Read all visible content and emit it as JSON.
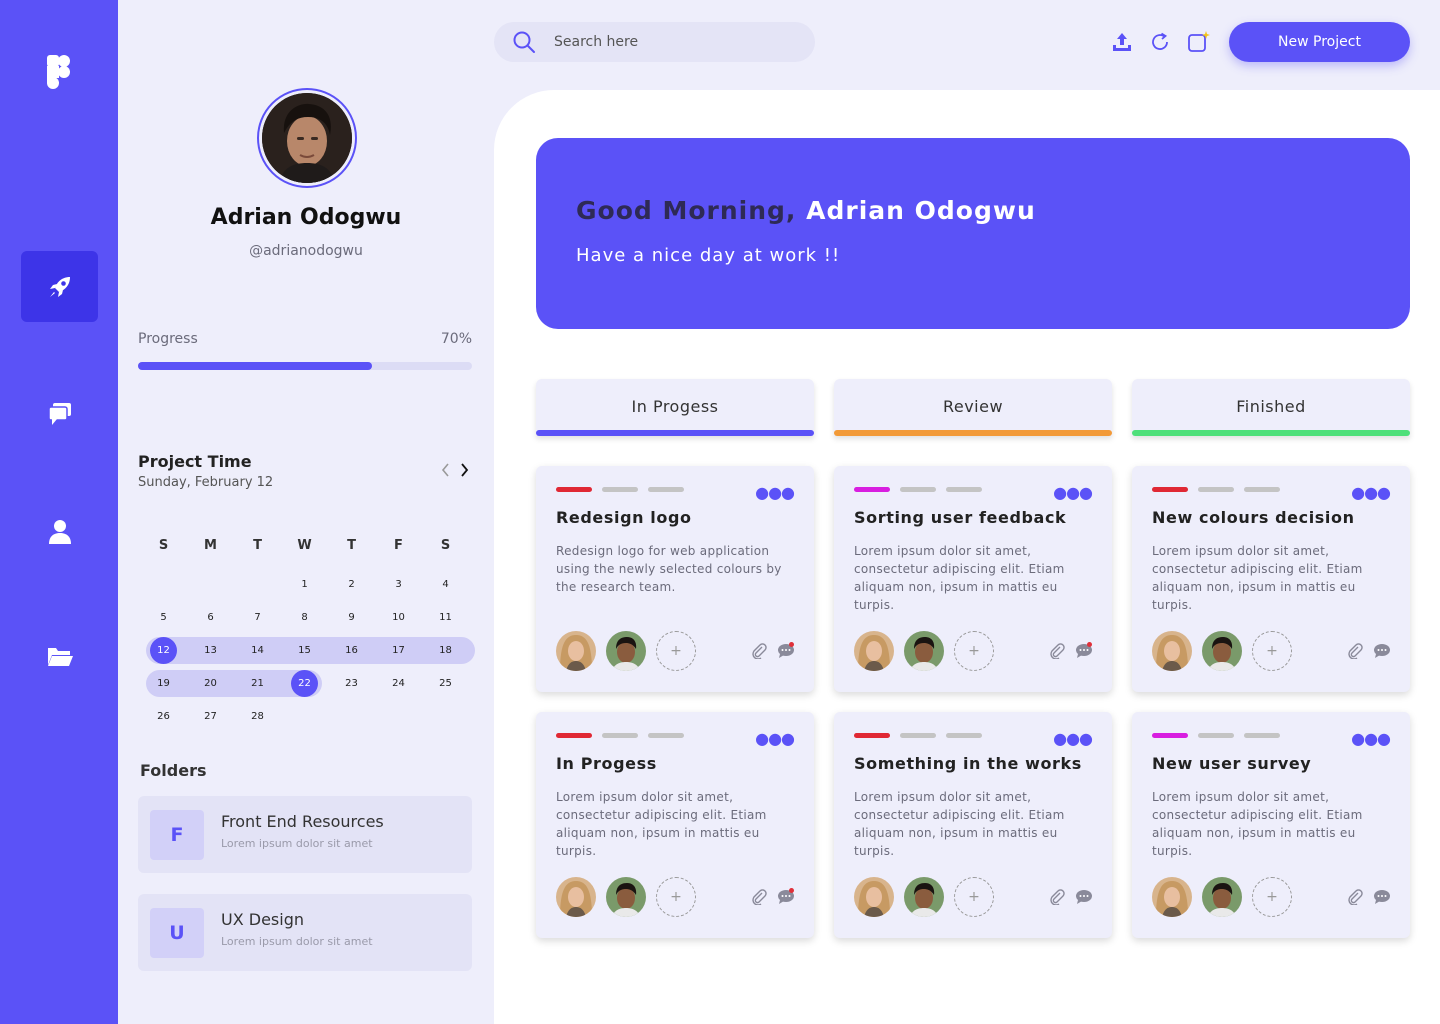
{
  "colors": {
    "accent": "#5b52f7",
    "nav_active": "#3d34e8",
    "review": "#f29a37",
    "finished": "#4fe07a",
    "tag_red": "#e02834",
    "tag_magenta": "#d81ee0",
    "tag_grey": "#c4c4c4"
  },
  "nav": {
    "items": [
      {
        "icon": "rocket-icon",
        "active": true
      },
      {
        "icon": "chat-icon",
        "active": false
      },
      {
        "icon": "user-icon",
        "active": false
      },
      {
        "icon": "folder-icon",
        "active": false
      }
    ]
  },
  "profile": {
    "name": "Adrian Odogwu",
    "handle": "@adrianodogwu",
    "progress_label": "Progress",
    "progress_value": "70%",
    "progress_fraction": 0.7
  },
  "project_time": {
    "title": "Project Time",
    "date": "Sunday, February 12",
    "weekdays": [
      "S",
      "M",
      "T",
      "W",
      "T",
      "F",
      "S"
    ],
    "weeks": [
      [
        "",
        "",
        "",
        "1",
        "2",
        "3",
        "4"
      ],
      [
        "5",
        "6",
        "7",
        "8",
        "9",
        "10",
        "11"
      ],
      [
        "12",
        "13",
        "14",
        "15",
        "16",
        "17",
        "18"
      ],
      [
        "19",
        "20",
        "21",
        "22",
        "23",
        "24",
        "25"
      ],
      [
        "26",
        "27",
        "28",
        "",
        "",
        "",
        ""
      ]
    ],
    "selected_start": "12",
    "selected_end": "22"
  },
  "folders": {
    "title": "Folders",
    "items": [
      {
        "badge": "F",
        "name": "Front End Resources",
        "sub": "Lorem ipsum dolor sit amet"
      },
      {
        "badge": "U",
        "name": "UX Design",
        "sub": "Lorem ipsum dolor sit amet"
      }
    ]
  },
  "topbar": {
    "search_placeholder": "Search here",
    "new_project_label": "New Project",
    "icons": [
      "upload-icon",
      "refresh-icon",
      "new-window-icon"
    ]
  },
  "hero": {
    "greeting": "Good Morning,",
    "name": "Adrian Odogwu",
    "subtitle": "Have a nice day at work !!"
  },
  "columns": [
    {
      "label": "In Progess",
      "color": "#5b52f7"
    },
    {
      "label": "Review",
      "color": "#f29a37"
    },
    {
      "label": "Finished",
      "color": "#4fe07a"
    }
  ],
  "cards": [
    {
      "title": "Redesign logo",
      "desc": "Redesign logo for web application using the newly selected colours by the research team.",
      "tag": "#e02834",
      "notif": true
    },
    {
      "title": "Sorting user feedback",
      "desc": "Lorem ipsum dolor sit amet, consectetur adipiscing elit. Etiam aliquam non, ipsum in mattis eu turpis.",
      "tag": "#d81ee0",
      "notif": true
    },
    {
      "title": "New colours decision",
      "desc": "Lorem ipsum dolor sit amet, consectetur adipiscing elit. Etiam aliquam non, ipsum in mattis eu turpis.",
      "tag": "#e02834",
      "notif": false
    },
    {
      "title": "In Progess",
      "desc": "Lorem ipsum dolor sit amet, consectetur adipiscing elit. Etiam aliquam non, ipsum in mattis eu turpis.",
      "tag": "#e02834",
      "notif": true
    },
    {
      "title": "Something in the works",
      "desc": "Lorem ipsum dolor sit amet, consectetur adipiscing elit. Etiam aliquam non, ipsum in mattis eu turpis.",
      "tag": "#e02834",
      "notif": false
    },
    {
      "title": "New user survey",
      "desc": "Lorem ipsum dolor sit amet, consectetur adipiscing elit. Etiam aliquam non, ipsum in mattis eu turpis.",
      "tag": "#d81ee0",
      "notif": false
    }
  ]
}
